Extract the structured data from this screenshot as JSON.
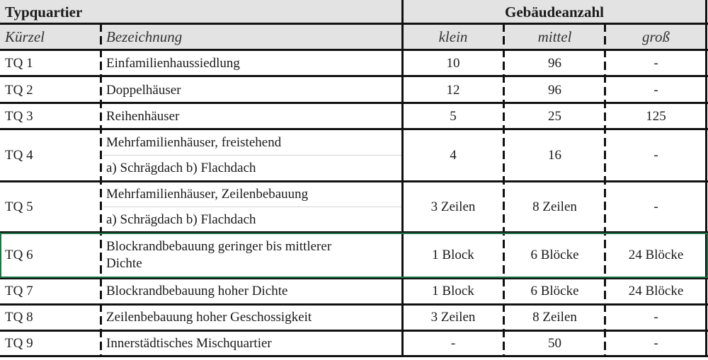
{
  "table": {
    "group_headers": {
      "left": "Typquartier",
      "right": "Gebäudeanzahl"
    },
    "columns": [
      "Kürzel",
      "Bezeichnung",
      "klein",
      "mittel",
      "groß"
    ],
    "rows": [
      {
        "code": "TQ 1",
        "name": [
          "Einfamilienhaussiedlung"
        ],
        "klein": "10",
        "mittel": "96",
        "gross": "-"
      },
      {
        "code": "TQ 2",
        "name": [
          "Doppelhäuser"
        ],
        "klein": "12",
        "mittel": "96",
        "gross": "-"
      },
      {
        "code": "TQ 3",
        "name": [
          "Reihenhäuser"
        ],
        "klein": "5",
        "mittel": "25",
        "gross": "125"
      },
      {
        "code": "TQ 4",
        "name": [
          "Mehrfamilienhäuser, freistehend",
          "a) Schrägdach b) Flachdach"
        ],
        "klein": "4",
        "mittel": "16",
        "gross": "-"
      },
      {
        "code": "TQ 5",
        "name": [
          "Mehrfamilienhäuser, Zeilenbebauung",
          "a) Schrägdach  b) Flachdach"
        ],
        "klein": "3 Zeilen",
        "mittel": "8 Zeilen",
        "gross": "-"
      },
      {
        "code": "TQ 6",
        "name": [
          "Blockrandbebauung geringer bis mittlerer",
          "Dichte"
        ],
        "klein": "1 Block",
        "mittel": "6 Blöcke",
        "gross": "24 Blöcke"
      },
      {
        "code": "TQ 7",
        "name": [
          "Blockrandbebauung hoher Dichte"
        ],
        "klein": "1 Block",
        "mittel": "6 Blöcke",
        "gross": "24 Blöcke"
      },
      {
        "code": "TQ 8",
        "name": [
          "Zeilenbebauung hoher Geschossigkeit"
        ],
        "klein": "3 Zeilen",
        "mittel": "8 Zeilen",
        "gross": "-"
      },
      {
        "code": "TQ 9",
        "name": [
          "Innerstädtisches Mischquartier"
        ],
        "klein": "-",
        "mittel": "50",
        "gross": "-"
      }
    ]
  },
  "colors": {
    "header_bg": "#e3e3e3",
    "selection_border": "#217346",
    "grid_line": "#111111"
  }
}
